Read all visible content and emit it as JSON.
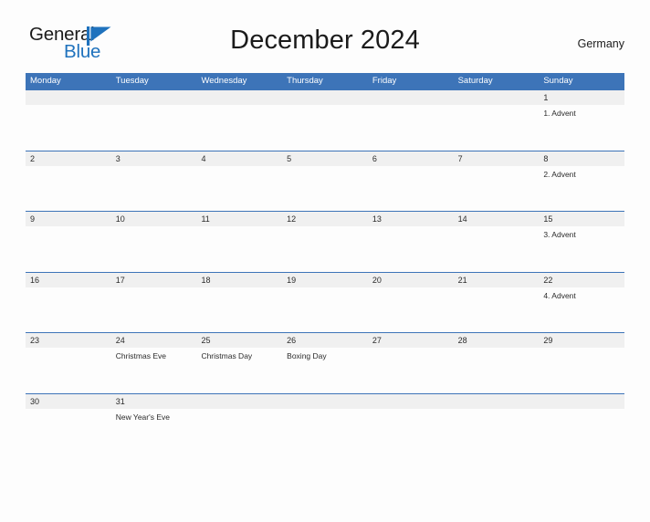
{
  "brand": {
    "name_part1": "General",
    "name_part2": "Blue",
    "flag_icon": "blue-triangle-flag-icon",
    "color_primary": "#1f72bd",
    "color_text": "#1b1b1b"
  },
  "header": {
    "title": "December 2024",
    "country": "Germany"
  },
  "calendar": {
    "accent_color": "#3d74b8",
    "band_color": "#f0f0f0",
    "weekdays": [
      "Monday",
      "Tuesday",
      "Wednesday",
      "Thursday",
      "Friday",
      "Saturday",
      "Sunday"
    ],
    "weeks": [
      {
        "days": [
          {
            "date": "",
            "event": ""
          },
          {
            "date": "",
            "event": ""
          },
          {
            "date": "",
            "event": ""
          },
          {
            "date": "",
            "event": ""
          },
          {
            "date": "",
            "event": ""
          },
          {
            "date": "",
            "event": ""
          },
          {
            "date": "1",
            "event": "1. Advent"
          }
        ]
      },
      {
        "days": [
          {
            "date": "2",
            "event": ""
          },
          {
            "date": "3",
            "event": ""
          },
          {
            "date": "4",
            "event": ""
          },
          {
            "date": "5",
            "event": ""
          },
          {
            "date": "6",
            "event": ""
          },
          {
            "date": "7",
            "event": ""
          },
          {
            "date": "8",
            "event": "2. Advent"
          }
        ]
      },
      {
        "days": [
          {
            "date": "9",
            "event": ""
          },
          {
            "date": "10",
            "event": ""
          },
          {
            "date": "11",
            "event": ""
          },
          {
            "date": "12",
            "event": ""
          },
          {
            "date": "13",
            "event": ""
          },
          {
            "date": "14",
            "event": ""
          },
          {
            "date": "15",
            "event": "3. Advent"
          }
        ]
      },
      {
        "days": [
          {
            "date": "16",
            "event": ""
          },
          {
            "date": "17",
            "event": ""
          },
          {
            "date": "18",
            "event": ""
          },
          {
            "date": "19",
            "event": ""
          },
          {
            "date": "20",
            "event": ""
          },
          {
            "date": "21",
            "event": ""
          },
          {
            "date": "22",
            "event": "4. Advent"
          }
        ]
      },
      {
        "days": [
          {
            "date": "23",
            "event": ""
          },
          {
            "date": "24",
            "event": "Christmas Eve"
          },
          {
            "date": "25",
            "event": "Christmas Day"
          },
          {
            "date": "26",
            "event": "Boxing Day"
          },
          {
            "date": "27",
            "event": ""
          },
          {
            "date": "28",
            "event": ""
          },
          {
            "date": "29",
            "event": ""
          }
        ]
      },
      {
        "days": [
          {
            "date": "30",
            "event": ""
          },
          {
            "date": "31",
            "event": "New Year's Eve"
          },
          {
            "date": "",
            "event": ""
          },
          {
            "date": "",
            "event": ""
          },
          {
            "date": "",
            "event": ""
          },
          {
            "date": "",
            "event": ""
          },
          {
            "date": "",
            "event": ""
          }
        ]
      }
    ]
  }
}
